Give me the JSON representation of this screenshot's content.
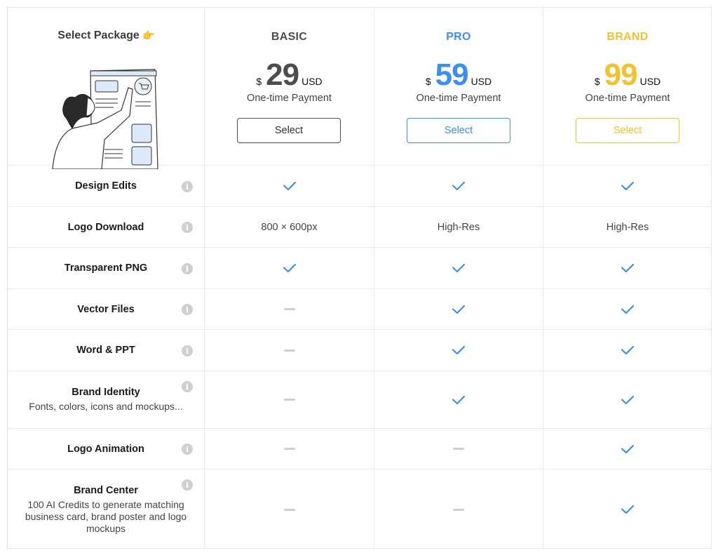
{
  "header": {
    "title": "Select Package",
    "title_emoji": "👉",
    "illustration": "person-pointing-at-shopping-cart-illustration"
  },
  "plans": [
    {
      "name": "BASIC",
      "currency": "$",
      "price": "29",
      "unit": "USD",
      "billing": "One-time Payment",
      "button_label": "Select",
      "color": "#4d4d4d"
    },
    {
      "name": "PRO",
      "currency": "$",
      "price": "59",
      "unit": "USD",
      "billing": "One-time Payment",
      "button_label": "Select",
      "color": "#3a8ff0"
    },
    {
      "name": "BRAND",
      "currency": "$",
      "price": "99",
      "unit": "USD",
      "billing": "One-time Payment",
      "button_label": "Select",
      "color": "#f4c12e"
    }
  ],
  "features": [
    {
      "name": "Design Edits",
      "description": "",
      "values": [
        "check",
        "check",
        "check"
      ]
    },
    {
      "name": "Logo Download",
      "description": "",
      "values": [
        "800 × 600px",
        "High-Res",
        "High-Res"
      ]
    },
    {
      "name": "Transparent PNG",
      "description": "",
      "values": [
        "check",
        "check",
        "check"
      ]
    },
    {
      "name": "Vector Files",
      "description": "",
      "values": [
        "dash",
        "check",
        "check"
      ]
    },
    {
      "name": "Word & PPT",
      "description": "",
      "values": [
        "dash",
        "check",
        "check"
      ]
    },
    {
      "name": "Brand Identity",
      "description": "Fonts, colors, icons and mockups...",
      "values": [
        "dash",
        "check",
        "check"
      ]
    },
    {
      "name": "Logo Animation",
      "description": "",
      "values": [
        "dash",
        "dash",
        "check"
      ]
    },
    {
      "name": "Brand Center",
      "description": "100 AI Credits to generate matching business card, brand poster and logo mockups",
      "values": [
        "dash",
        "dash",
        "check"
      ]
    }
  ],
  "icons": {
    "info": "info-icon",
    "included": "checkmark-icon",
    "not_included": "dash-icon"
  },
  "colors": {
    "check": "#3a8ff0",
    "dash": "#cfcfcf",
    "info": "#cfcfcf",
    "border": "#e9e9e9"
  }
}
